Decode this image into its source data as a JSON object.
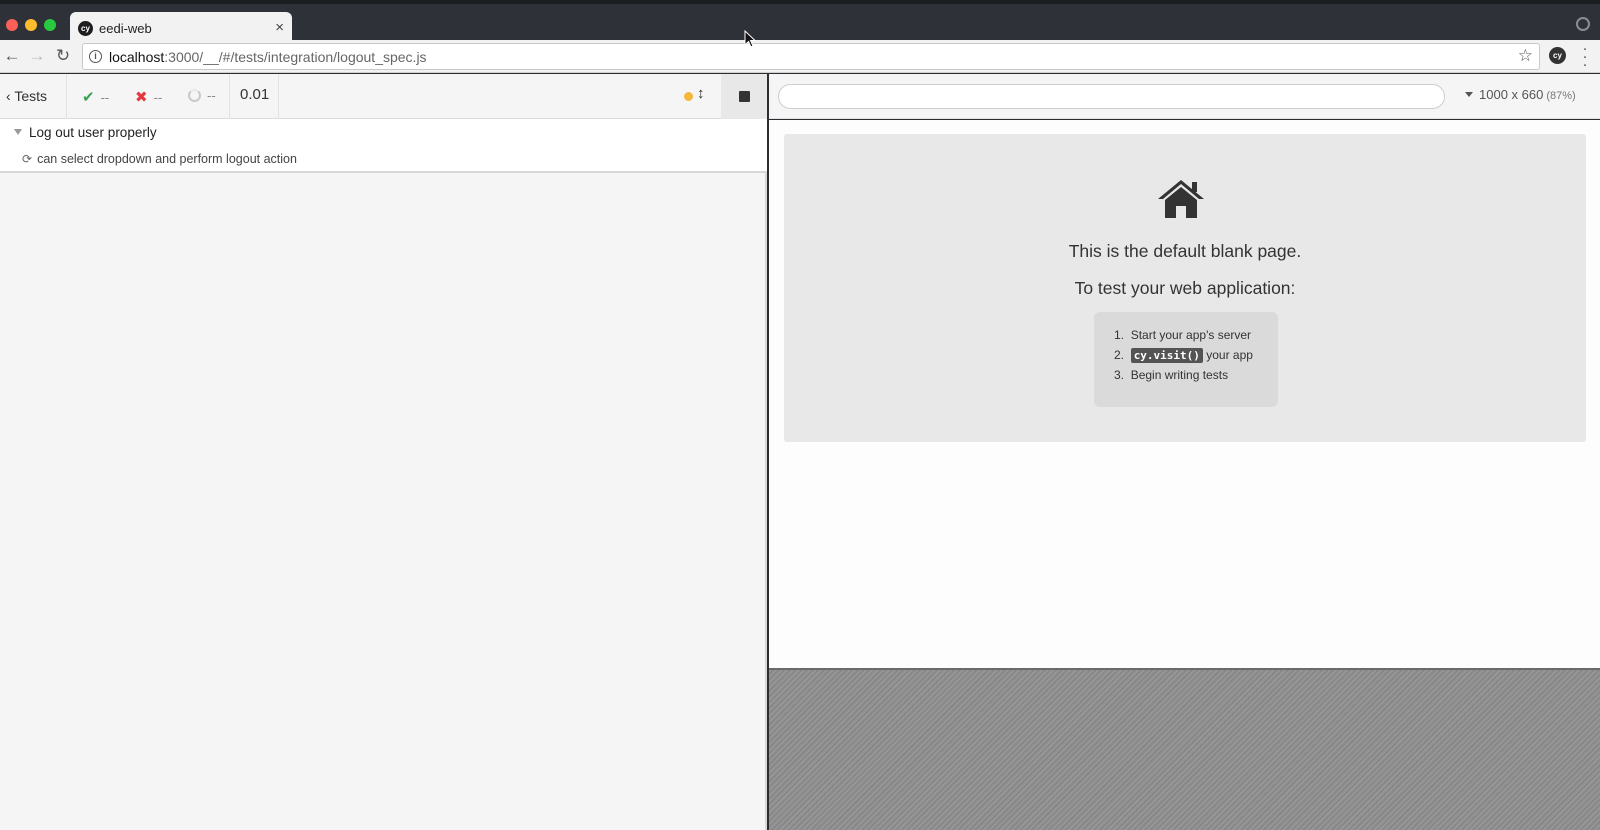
{
  "browser": {
    "tab_title": "eedi-web",
    "favicon_text": "cy",
    "tab_close": "×",
    "url_host": "localhost",
    "url_rest": ":3000/__/#/tests/integration/logout_spec.js",
    "extension_text": "cy"
  },
  "reporter": {
    "tests_label": "Tests",
    "passed": "--",
    "failed": "--",
    "pending": "--",
    "duration": "0.01",
    "suite_title": "Log out user properly",
    "test_title": "can select dropdown and perform logout action"
  },
  "aut": {
    "url_value": "",
    "viewport": "1000 x 660",
    "scale": "(87%)",
    "blank_title": "This is the default blank page.",
    "blank_sub": "To test your web application:",
    "steps": {
      "s1": "Start your app's server",
      "s2_code": "cy.visit()",
      "s2_rest": " your app",
      "s3": "Begin writing tests"
    }
  },
  "colors": {
    "accent_running": "#f4b63b",
    "pass": "#3aa057",
    "fail": "#e2383f"
  }
}
